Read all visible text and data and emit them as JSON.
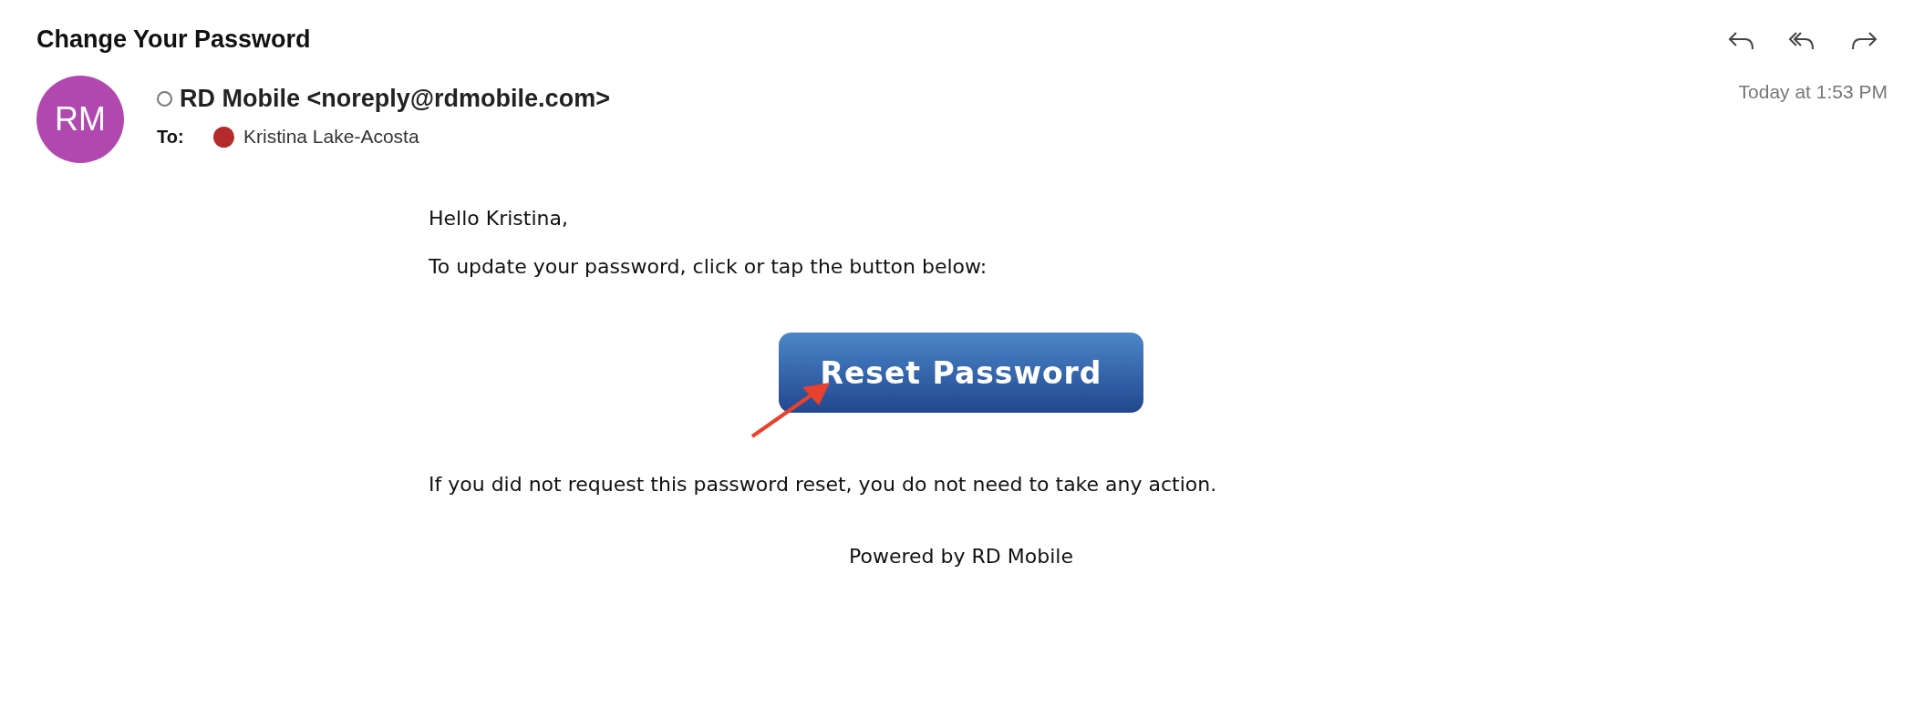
{
  "message": {
    "subject": "Change Your Password",
    "actions": [
      {
        "kind": "reply"
      },
      {
        "kind": "reply-all"
      },
      {
        "kind": "forward"
      }
    ],
    "avatar": {
      "initials": "RM",
      "color": "#b148b0"
    },
    "sender": "RD Mobile <noreply@rdmobile.com>",
    "to_label": "To:",
    "recipient": {
      "name": "Kristina Lake-Acosta",
      "color": "#b52a2a"
    },
    "time": "Today at 1:53 PM"
  },
  "body": {
    "greeting": "Hello Kristina,",
    "instruction": "To update your password, click or tap the button below:",
    "button": "Reset Password",
    "note": "If you did not request this password reset, you do not need to take any action.",
    "footer": "Powered by RD Mobile"
  }
}
